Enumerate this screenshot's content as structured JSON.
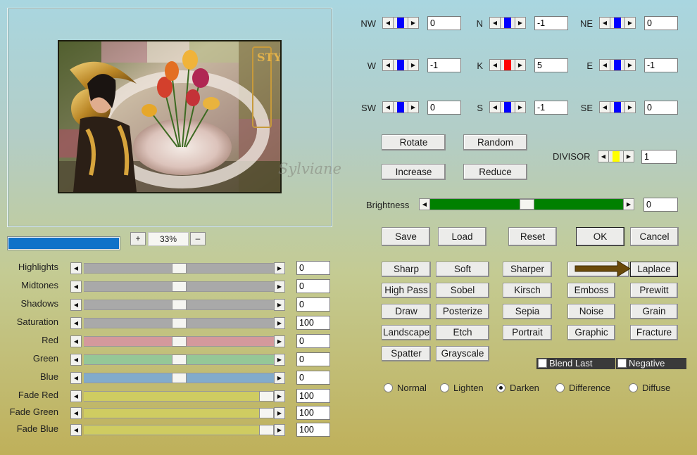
{
  "preview": {
    "zoom": {
      "minus": "+",
      "value": "33%",
      "plus": "–"
    },
    "watermark": "Sylviane",
    "image_style_text": "STYLE"
  },
  "sliders": [
    {
      "label": "Highlights",
      "value": "0",
      "level": 0.5,
      "track": "#a9a9a9"
    },
    {
      "label": "Midtones",
      "value": "0",
      "level": 0.5,
      "track": "#a9a9a9"
    },
    {
      "label": "Shadows",
      "value": "0",
      "level": 0.5,
      "track": "#a9a9a9"
    },
    {
      "label": "Saturation",
      "value": "100",
      "level": 0.5,
      "track": "#a9a9a9"
    },
    {
      "label": "Red",
      "value": "0",
      "level": 0.5,
      "track": "#d4999c"
    },
    {
      "label": "Green",
      "value": "0",
      "level": 0.5,
      "track": "#95c797"
    },
    {
      "label": "Blue",
      "value": "0",
      "level": 0.5,
      "track": "#82abcb"
    },
    {
      "label": "Fade Red",
      "value": "100",
      "level": 1.0,
      "track": "#cfcc61"
    },
    {
      "label": "Fade Green",
      "value": "100",
      "level": 1.0,
      "track": "#cfcc61"
    },
    {
      "label": "Fade Blue",
      "value": "100",
      "level": 1.0,
      "track": "#cfcc61"
    }
  ],
  "kernel": {
    "cells": [
      {
        "label": "NW",
        "value": "0",
        "color": "#0000ff"
      },
      {
        "label": "N",
        "value": "-1",
        "color": "#0000ff"
      },
      {
        "label": "NE",
        "value": "0",
        "color": "#0000ff"
      },
      {
        "label": "W",
        "value": "-1",
        "color": "#0000ff"
      },
      {
        "label": "K",
        "value": "5",
        "color": "#ff0000"
      },
      {
        "label": "E",
        "value": "-1",
        "color": "#0000ff"
      },
      {
        "label": "SW",
        "value": "0",
        "color": "#0000ff"
      },
      {
        "label": "S",
        "value": "-1",
        "color": "#0000ff"
      },
      {
        "label": "SE",
        "value": "0",
        "color": "#0000ff"
      }
    ],
    "divisor": {
      "label": "DIVISOR",
      "value": "1",
      "color": "#ffff00"
    }
  },
  "buttons": {
    "rotate": "Rotate",
    "random": "Random",
    "increase": "Increase",
    "reduce": "Reduce",
    "save": "Save",
    "load": "Load",
    "reset": "Reset",
    "ok": "OK",
    "cancel": "Cancel"
  },
  "brightness": {
    "label": "Brightness",
    "value": "0",
    "level": 0.5,
    "track_color": "#008000"
  },
  "presets": [
    [
      "Sharp",
      "Soft",
      "Sharper",
      "",
      "Laplace"
    ],
    [
      "High Pass",
      "Sobel",
      "Kirsch",
      "Emboss",
      "Prewitt"
    ],
    [
      "Draw",
      "Posterize",
      "Sepia",
      "Noise",
      "Grain"
    ],
    [
      "Landscape",
      "Etch",
      "Portrait",
      "Graphic",
      "Fracture"
    ],
    [
      "Spatter",
      "Grayscale",
      "",
      "",
      ""
    ]
  ],
  "options": {
    "blend_last": {
      "label": "Blend Last",
      "checked": false
    },
    "negative": {
      "label": "Negative",
      "checked": false
    },
    "modes": [
      {
        "label": "Normal",
        "selected": false
      },
      {
        "label": "Lighten",
        "selected": false
      },
      {
        "label": "Darken",
        "selected": true
      },
      {
        "label": "Difference",
        "selected": false
      },
      {
        "label": "Diffuse",
        "selected": false
      }
    ]
  },
  "colors": {
    "progress": "#0f72c9",
    "arrow_annotation": "#6b4a0a",
    "option_box": "#3a3a3a"
  }
}
